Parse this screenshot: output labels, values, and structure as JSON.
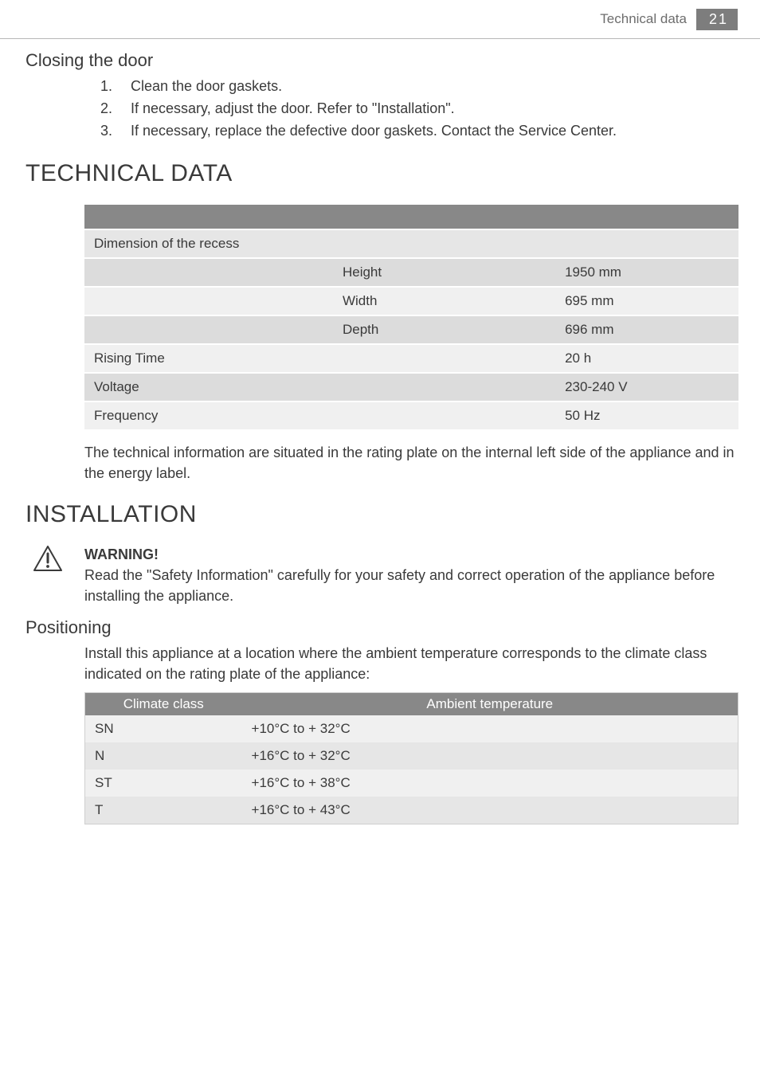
{
  "header": {
    "section": "Technical data",
    "page": "21"
  },
  "closing_door": {
    "heading": "Closing the door",
    "steps": [
      {
        "num": "1.",
        "text": "Clean the door gaskets."
      },
      {
        "num": "2.",
        "text": "If necessary, adjust the door. Refer to \"Installation\"."
      },
      {
        "num": "3.",
        "text": "If necessary, replace the defective door gaskets. Contact the Service Center."
      }
    ]
  },
  "technical_data": {
    "heading": "TECHNICAL DATA",
    "rows": [
      {
        "c1": "Dimension of the recess",
        "c2": "",
        "c3": "",
        "style": "r-lighter"
      },
      {
        "c1": "",
        "c2": "Height",
        "c3": "1950 mm",
        "style": "r-darker"
      },
      {
        "c1": "",
        "c2": "Width",
        "c3": "695 mm",
        "style": "r-light"
      },
      {
        "c1": "",
        "c2": "Depth",
        "c3": "696 mm",
        "style": "r-darker"
      },
      {
        "c1": "Rising Time",
        "c2": "",
        "c3": "20 h",
        "style": "r-light"
      },
      {
        "c1": "Voltage",
        "c2": "",
        "c3": "230-240 V",
        "style": "r-darker"
      },
      {
        "c1": "Frequency",
        "c2": "",
        "c3": "50 Hz",
        "style": "r-light"
      }
    ],
    "note": "The technical information are situated in the rating plate on the internal left side of the appliance and in the energy label."
  },
  "installation": {
    "heading": "INSTALLATION",
    "warning_title": "WARNING!",
    "warning_text": "Read the \"Safety Information\" carefully for your safety and correct operation of the appliance before installing the appliance."
  },
  "positioning": {
    "heading": "Positioning",
    "intro": "Install this appliance at a location where the ambient temperature corresponds to the climate class indicated on the rating plate of the appliance:",
    "th_class": "Climate class",
    "th_temp": "Ambient temperature",
    "rows": [
      {
        "class": "SN",
        "temp": "+10°C to + 32°C"
      },
      {
        "class": "N",
        "temp": "+16°C to + 32°C"
      },
      {
        "class": "ST",
        "temp": "+16°C to + 38°C"
      },
      {
        "class": "T",
        "temp": "+16°C to + 43°C"
      }
    ]
  }
}
